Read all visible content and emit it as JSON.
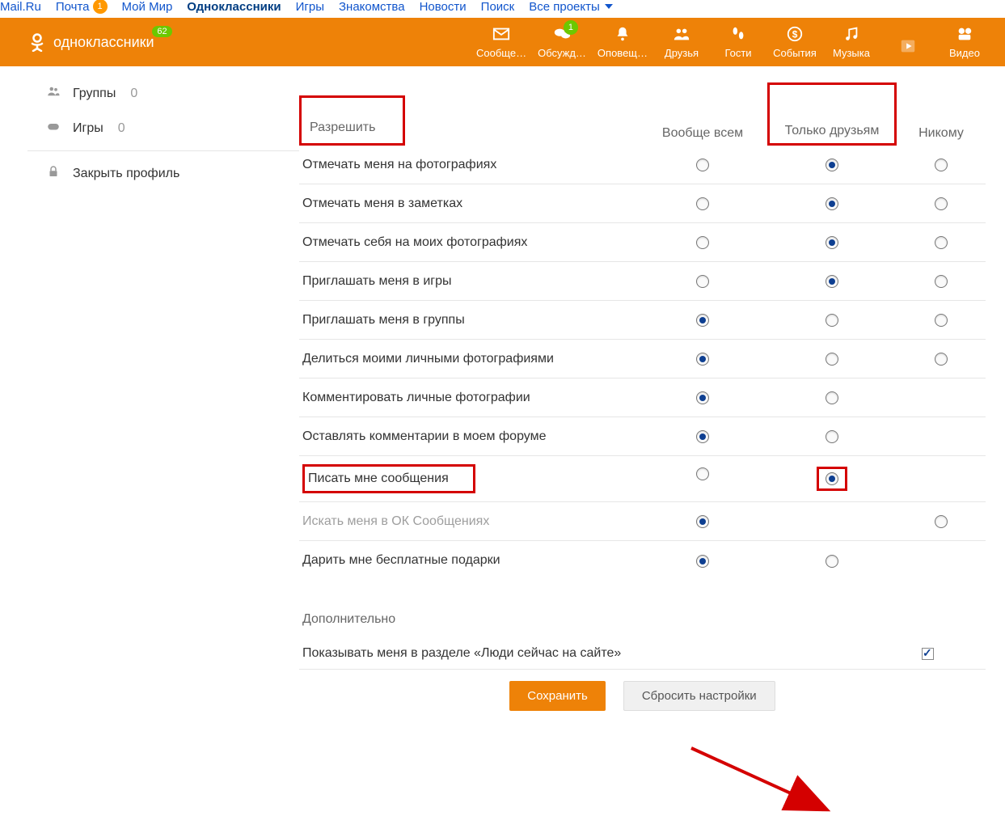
{
  "mailbar": {
    "items": [
      {
        "label": "Mail.Ru"
      },
      {
        "label": "Почта",
        "badge": "1"
      },
      {
        "label": "Мой Мир"
      },
      {
        "label": "Одноклассники",
        "active": true
      },
      {
        "label": "Игры"
      },
      {
        "label": "Знакомства"
      },
      {
        "label": "Новости"
      },
      {
        "label": "Поиск"
      },
      {
        "label": "Все проекты",
        "caret": true
      }
    ]
  },
  "header": {
    "logo_text": "одноклассники",
    "logo_badge": "62",
    "items": [
      {
        "label": "Сообще…",
        "icon": "envelope"
      },
      {
        "label": "Обсужд…",
        "icon": "chat",
        "badge": "1"
      },
      {
        "label": "Оповещ…",
        "icon": "bell"
      },
      {
        "label": "Друзья",
        "icon": "friends"
      },
      {
        "label": "Гости",
        "icon": "footprints"
      },
      {
        "label": "События",
        "icon": "coin"
      },
      {
        "label": "Музыка",
        "icon": "music"
      },
      {
        "label": "",
        "icon": "play"
      },
      {
        "label": "Видео",
        "icon": "video"
      }
    ]
  },
  "sidebar": {
    "items": [
      {
        "icon": "group",
        "label": "Группы",
        "count": "0"
      },
      {
        "icon": "gamepad",
        "label": "Игры",
        "count": "0"
      }
    ],
    "lock_label": "Закрыть профиль"
  },
  "permissions": {
    "title": "Разрешить",
    "columns": [
      "Вообще всем",
      "Только друзьям",
      "Никому"
    ],
    "rows": [
      {
        "label": "Отмечать меня на фотографиях",
        "sel": 1,
        "cols3": true
      },
      {
        "label": "Отмечать меня в заметках",
        "sel": 1,
        "cols3": true
      },
      {
        "label": "Отмечать себя на моих фотографиях",
        "sel": 1,
        "cols3": true
      },
      {
        "label": "Приглашать меня в игры",
        "sel": 1,
        "cols3": true
      },
      {
        "label": "Приглашать меня в группы",
        "sel": 0,
        "cols3": true
      },
      {
        "label": "Делиться моими личными фотографиями",
        "sel": 0,
        "cols3": true
      },
      {
        "label": "Комментировать личные фотографии",
        "sel": 0,
        "cols2": true
      },
      {
        "label": "Оставлять комментарии в моем форуме",
        "sel": 0,
        "cols2": true
      },
      {
        "label": "Писать мне сообщения",
        "sel": 1,
        "cols2": true,
        "hlLabel": true,
        "hlCell": 1
      },
      {
        "label": "Искать меня в ОК Сообщениях",
        "sel": 0,
        "cols13": true,
        "disabled": true
      },
      {
        "label": "Дарить мне бесплатные подарки",
        "sel": 0,
        "cols2": true,
        "noborder": true
      }
    ]
  },
  "additional": {
    "title": "Дополнительно",
    "row_label": "Показывать меня в разделе «Люди сейчас на сайте»",
    "checked": true
  },
  "buttons": {
    "save": "Сохранить",
    "reset": "Сбросить настройки"
  }
}
